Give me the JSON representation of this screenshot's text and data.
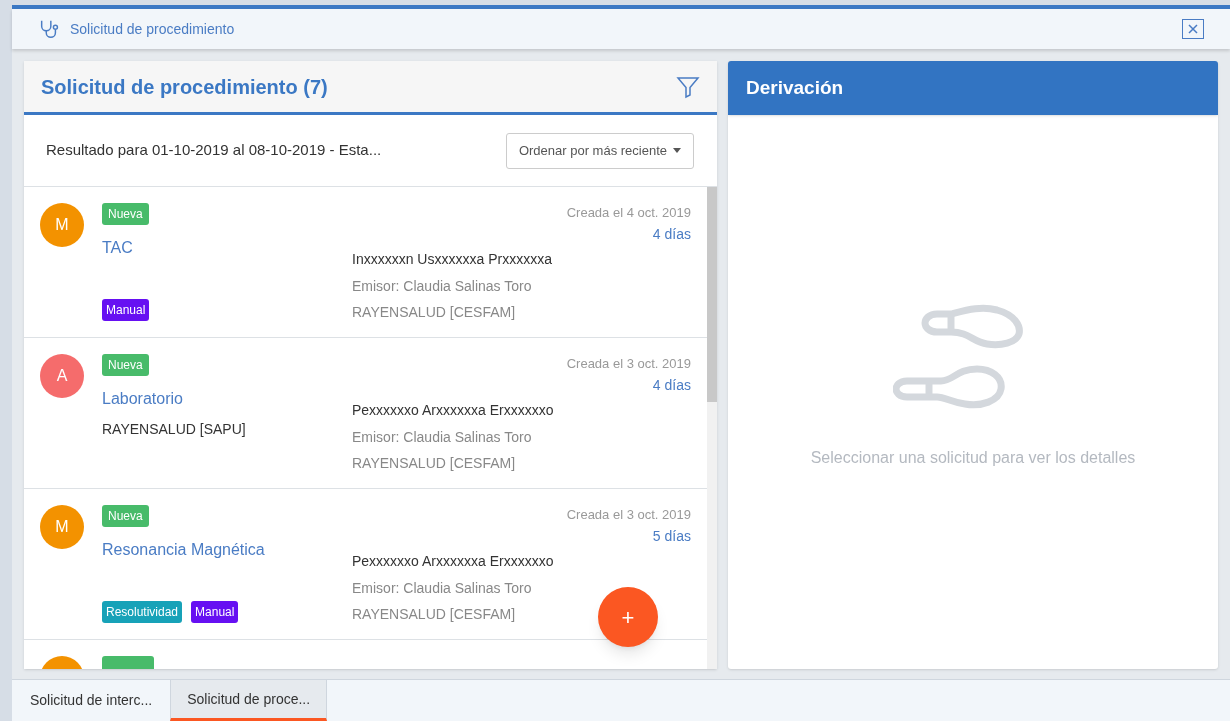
{
  "window": {
    "title": "Solicitud de procedimiento"
  },
  "list_panel": {
    "title": "Solicitud de procedimiento (7)",
    "result_text": "Resultado para 01-10-2019 al 08-10-2019 - Esta...",
    "sort_button": "Ordenar por más reciente",
    "items": [
      {
        "avatar": {
          "letter": "M",
          "color": "#f39200"
        },
        "status": {
          "label": "Nueva",
          "color": "#48bb6a"
        },
        "title": "TAC",
        "tags": [
          {
            "label": "Manual",
            "color": "#6610f2"
          }
        ],
        "created": "Creada el 4 oct. 2019",
        "age": "4 días",
        "patient": "Inxxxxxxn Usxxxxxxa Prxxxxxxa",
        "issuer": "Emisor: Claudia Salinas Toro",
        "origin": "RAYENSALUD [CESFAM]"
      },
      {
        "avatar": {
          "letter": "A",
          "color": "#f56c6c"
        },
        "status": {
          "label": "Nueva",
          "color": "#48bb6a"
        },
        "title": "Laboratorio",
        "subtitle": "RAYENSALUD [SAPU]",
        "created": "Creada el 3 oct. 2019",
        "age": "4 días",
        "patient": "Pexxxxxxo Arxxxxxxa Erxxxxxxo",
        "issuer": "Emisor: Claudia Salinas Toro",
        "origin": "RAYENSALUD [CESFAM]"
      },
      {
        "avatar": {
          "letter": "M",
          "color": "#f39200"
        },
        "status": {
          "label": "Nueva",
          "color": "#48bb6a"
        },
        "title": "Resonancia Magnética",
        "tags": [
          {
            "label": "Resolutividad",
            "color": "#17a2b8"
          },
          {
            "label": "Manual",
            "color": "#6610f2"
          }
        ],
        "created": "Creada el 3 oct. 2019",
        "age": "5 días",
        "patient": "Pexxxxxxo Arxxxxxxa Erxxxxxxo",
        "issuer": "Emisor: Claudia Salinas Toro",
        "origin": "RAYENSALUD [CESFAM]"
      }
    ],
    "add_button": "+"
  },
  "detail_panel": {
    "title": "Derivación",
    "empty_message": "Seleccionar una solicitud para ver los detalles"
  },
  "bottom_tabs": [
    {
      "label": "Solicitud de interc...",
      "selected": false
    },
    {
      "label": "Solicitud de proce...",
      "selected": true
    }
  ]
}
